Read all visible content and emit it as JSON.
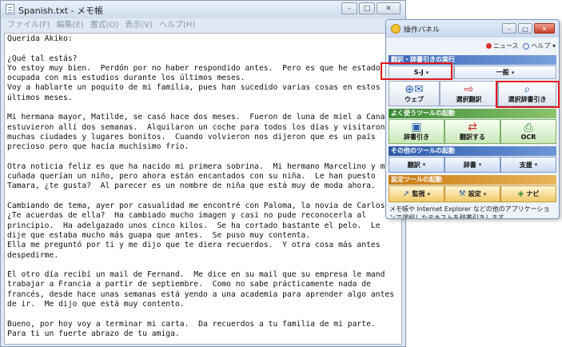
{
  "notepad": {
    "title": "Spanish.txt - メモ帳",
    "menu": [
      "ファイル(F)",
      "編集(E)",
      "書式(O)",
      "表示(V)",
      "ヘルプ(H)"
    ],
    "caption_buttons": [
      "–",
      "□",
      "✕"
    ],
    "text": "Querida Akiko:\n\n¿Qué tal estás?\nYo estoy muy bien.  Perdón por no haber respondido antes.  Pero es que he estado\nocupada con mis estudios durante los últimos meses.\nVoy a hablarte un poquito de mi familia, pues han sucedido varias cosas en estos\núltimos meses.\n\nMi hermana mayor, Matilde, se casó hace dos meses.  Fueron de luna de miel a Canad\nestuvieron allí dos semanas.  Alquilaron un coche para todos los días y visitaron\nmuchas ciudades y lugares bonitos.  Cuando volvieron nos dijeron que es un país\nprecioso pero que hacía muchísimo frío.\n\nOtra noticia feliz es que ha nacido mi primera sobrina.  Mi hermano Marcelino y m\ncuñada querían un niño, pero ahora están encantados con su niña.  Le han puesto\nTamara, ¿te gusta?  Al parecer es un nombre de niña que está muy de moda ahora.\n\nCambiando de tema, ayer por casualidad me encontré con Paloma, la novia de Carlos\n¿Te acuerdas de ella?  Ha cambiado mucho imagen y casi no pude reconocerla al\nprincipio.  Ha adelgazado unos cinco kilos.  Se ha cortado bastante el pelo.  Le\ndije que estaba mucho más guapa que antes.  Se puso muy contenta.\nElla me preguntó por ti y me dijo que te diera recuerdos.  Y otra cosa más antes\ndespedirme.\n\nEl otro día recibí un mail de Fernand.  Me dice en su mail que su empresa le mand\ntrabajar a Francia a partir de septiembre.  Como no sabe prácticamente nada de\nfrancés, desde hace unas semanas está yendo a una academia para aprender algo antes\nde ir.  Me dijo que está muy contento.\n\nBueno, por hoy voy a terminar mi carta.  Da recuerdos a tu familia de mi parte.\nPara ti un fuerte abrazo de tu amiga.\n\nAndrea"
  },
  "panel": {
    "title": "操作パネル",
    "caption_buttons": [
      "–",
      "□",
      "✕"
    ],
    "tools": [
      "ニュース",
      "ヘルプ ▾"
    ],
    "sections": {
      "translate": "翻訳・辞書引きの実行",
      "frequent": "よく使うツールの起動",
      "other": "その他のツールの起動",
      "settings": "設定ツールの起動"
    },
    "direction": "S-J",
    "field": "一般",
    "web_label": "ウェブ",
    "selection_translate": "選択翻訳",
    "selection_dictionary": "選択辞書引き",
    "dict_lookup": "辞書引き",
    "translate_btn": "翻訳する",
    "ocr": "OCR",
    "translate_menu": "翻訳",
    "dictionary_menu": "辞書",
    "support_menu": "支援",
    "monitor": "監視",
    "settings_btn": "設定",
    "navi": "ナビ",
    "description": "メモ帳や Internet Explorer などの他のアプリケーションで選択したテキストを辞書引きします。"
  },
  "colors": {
    "highlight": "#e0151b",
    "section_blue": "#3867b8",
    "section_green": "#3d8a3a",
    "section_orange": "#c87b12"
  }
}
